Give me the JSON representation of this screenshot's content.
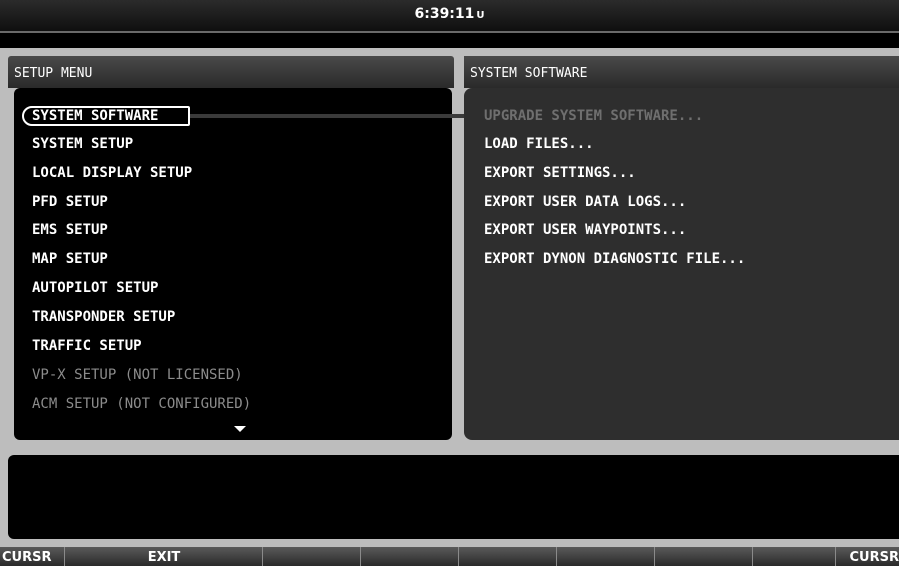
{
  "header": {
    "clock": "6:39:11",
    "clock_unit": "U"
  },
  "left_pane": {
    "title": "SETUP MENU",
    "items": [
      {
        "label": "SYSTEM SOFTWARE",
        "enabled": true,
        "selected": true
      },
      {
        "label": "SYSTEM SETUP",
        "enabled": true
      },
      {
        "label": "LOCAL DISPLAY SETUP",
        "enabled": true
      },
      {
        "label": "PFD SETUP",
        "enabled": true
      },
      {
        "label": "EMS SETUP",
        "enabled": true
      },
      {
        "label": "MAP SETUP",
        "enabled": true
      },
      {
        "label": "AUTOPILOT SETUP",
        "enabled": true
      },
      {
        "label": "TRANSPONDER SETUP",
        "enabled": true
      },
      {
        "label": "TRAFFIC SETUP",
        "enabled": true
      },
      {
        "label": "VP-X SETUP (NOT LICENSED)",
        "enabled": false
      },
      {
        "label": "ACM SETUP (NOT CONFIGURED)",
        "enabled": false
      }
    ],
    "scroll_indicator": "chevron-down-icon"
  },
  "right_pane": {
    "title": "SYSTEM SOFTWARE",
    "items": [
      {
        "label": "UPGRADE SYSTEM SOFTWARE...",
        "enabled": false
      },
      {
        "label": "LOAD FILES...",
        "enabled": true
      },
      {
        "label": "EXPORT SETTINGS...",
        "enabled": true
      },
      {
        "label": "EXPORT USER DATA LOGS...",
        "enabled": true
      },
      {
        "label": "EXPORT USER WAYPOINTS...",
        "enabled": true
      },
      {
        "label": "EXPORT DYNON DIAGNOSTIC FILE...",
        "enabled": true
      }
    ]
  },
  "softkeys": [
    "CURSR",
    "EXIT",
    "",
    "",
    "",
    "",
    "",
    "",
    "CURSR"
  ],
  "colors": {
    "frame": "#bdbdbd",
    "disabled_text": "#8c8c8c",
    "highlight_border": "#ffffff"
  }
}
